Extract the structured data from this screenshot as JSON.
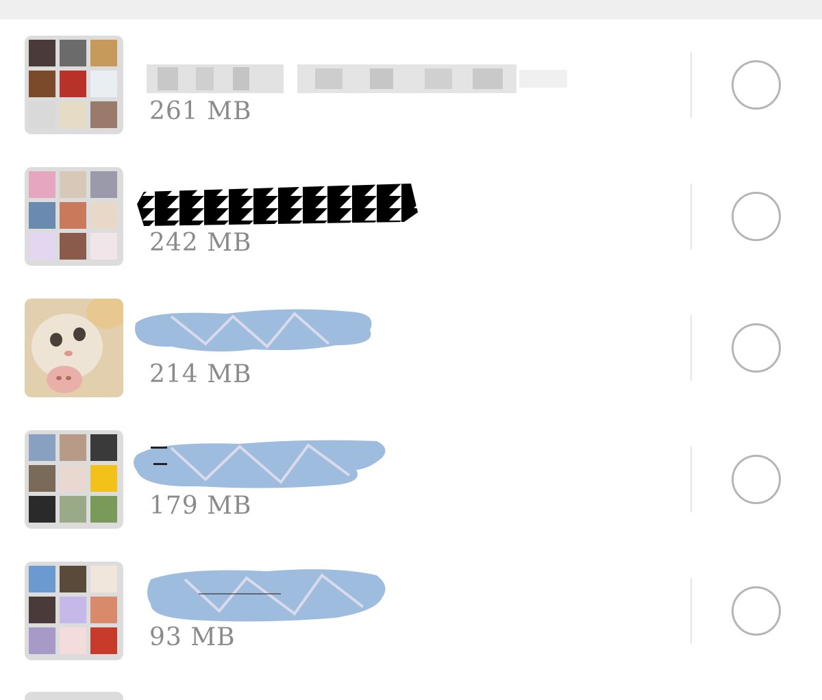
{
  "rows": [
    {
      "size": "261 MB",
      "avatar_type": "grid",
      "tiles": [
        "#4a3a3a",
        "#6b6b6b",
        "#c59a5a",
        "#7a4a2a",
        "#b8322a",
        "#e8eef2",
        "#d9d9d9",
        "#e6dcc6",
        "#9a7a6a"
      ]
    },
    {
      "size": "242 MB",
      "avatar_type": "grid",
      "tiles": [
        "#e7a6bf",
        "#d8c8b8",
        "#9a9aaa",
        "#6a8ab0",
        "#c87a5a",
        "#e8d8c8",
        "#e2d6f0",
        "#8a5a4a",
        "#f0e6ea"
      ]
    },
    {
      "size": "214 MB",
      "avatar_type": "single",
      "tiles": []
    },
    {
      "size": "179 MB",
      "avatar_type": "grid",
      "tiles": [
        "#8aa0c0",
        "#b89a88",
        "#3a3a3a",
        "#7a6a5a",
        "#e8d8d0",
        "#f2c21a",
        "#2a2a2a",
        "#9aaa88",
        "#7a9a5a"
      ]
    },
    {
      "size": "93 MB",
      "avatar_type": "grid",
      "tiles": [
        "#6a9ad0",
        "#5a4a3a",
        "#f0e6dc",
        "#4a3a3a",
        "#c6b8e8",
        "#d88a6a",
        "#a89ac8",
        "#f2dcdc",
        "#c83a2a"
      ]
    }
  ],
  "colors": {
    "size_text": "#8a8a8a",
    "radio_border": "#b5b5b5",
    "divider": "#e3e3e3",
    "redaction_blue": "#9dbcde",
    "top_bar": "#efefef"
  },
  "icons": {
    "radio": "radio-unchecked-icon"
  }
}
